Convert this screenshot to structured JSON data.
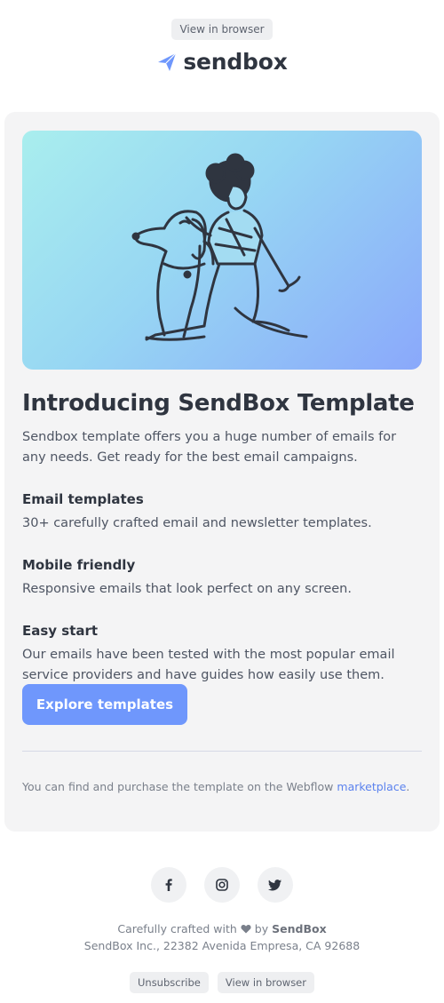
{
  "header": {
    "view_in_browser": "View in browser",
    "logo_text": "sendbox"
  },
  "main": {
    "title": "Introducing SendBox Template",
    "lead": "Sendbox template offers you a huge number of emails for any needs. Get ready for the best email campaigns.",
    "features": [
      {
        "title": "Email templates",
        "text": "30+ carefully crafted email and newsletter templates."
      },
      {
        "title": "Mobile friendly",
        "text": "Responsive emails that look perfect on any screen."
      },
      {
        "title": "Easy start",
        "text": "Our emails have been tested with the most popular email service providers and have guides how easily use them."
      }
    ],
    "cta_label": "Explore templates",
    "note_prefix": "You can find and purchase the template on the Webflow ",
    "note_link": "marketplace",
    "note_suffix": "."
  },
  "social": {
    "icons": [
      "facebook-icon",
      "instagram-icon",
      "twitter-icon"
    ]
  },
  "footer": {
    "crafted_prefix": "Carefully crafted with",
    "crafted_by": "by",
    "brand": "SendBox",
    "address": "SendBox Inc., 22382 Avenida Empresa, CA 92688",
    "unsubscribe": "Unsubscribe",
    "view_in_browser": "View in browser"
  },
  "colors": {
    "accent": "#6f97fc",
    "link": "#5b82ee",
    "card_bg": "#f4f4f5",
    "heart": "#7a808b"
  }
}
